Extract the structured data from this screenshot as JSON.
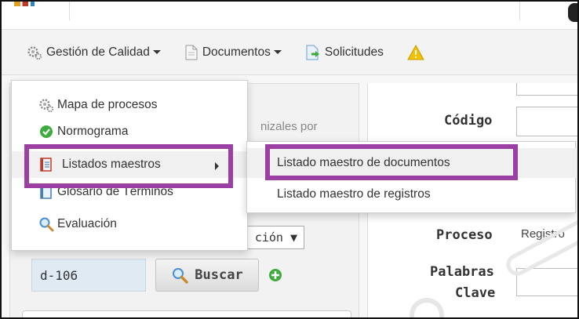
{
  "colors": {
    "highlight_border": "#9b3fa3",
    "success_green": "#3dab3d",
    "warning_yellow": "#f2c200"
  },
  "navbar": {
    "items": [
      {
        "label": "Gestión de Calidad",
        "icon": "gears-icon",
        "has_caret": true
      },
      {
        "label": "Documentos",
        "icon": "document-icon",
        "has_caret": true
      },
      {
        "label": "Solicitudes",
        "icon": "document-arrow-icon",
        "has_caret": false
      },
      {
        "label": "",
        "icon": "warning-icon",
        "has_caret": false
      }
    ]
  },
  "dropdown": {
    "items": [
      {
        "label": "Mapa de procesos",
        "icon": "gears-icon"
      },
      {
        "label": "Normograma",
        "icon": "check-circle-icon"
      },
      {
        "label": "Listados maestros",
        "icon": "list-book-icon",
        "has_submenu": true
      },
      {
        "label": "Glosario de Términos",
        "icon": "glossary-book-icon"
      },
      {
        "label": "Evaluación",
        "icon": "magnifier-icon"
      }
    ]
  },
  "submenu": {
    "items": [
      {
        "label": "Listado maestro de documentos"
      },
      {
        "label": "Listado maestro de registros"
      }
    ]
  },
  "left_panel": {
    "partial_text": "nizales por",
    "select_value": "ción ▼",
    "search_value": "d-106",
    "search_button_label": "Buscar"
  },
  "right_panel": {
    "codigo_label": "Código",
    "proceso_label": "Proceso",
    "proceso_value": "Registro",
    "palabras_label_line1": "Palabras",
    "palabras_label_line2": "Clave"
  }
}
